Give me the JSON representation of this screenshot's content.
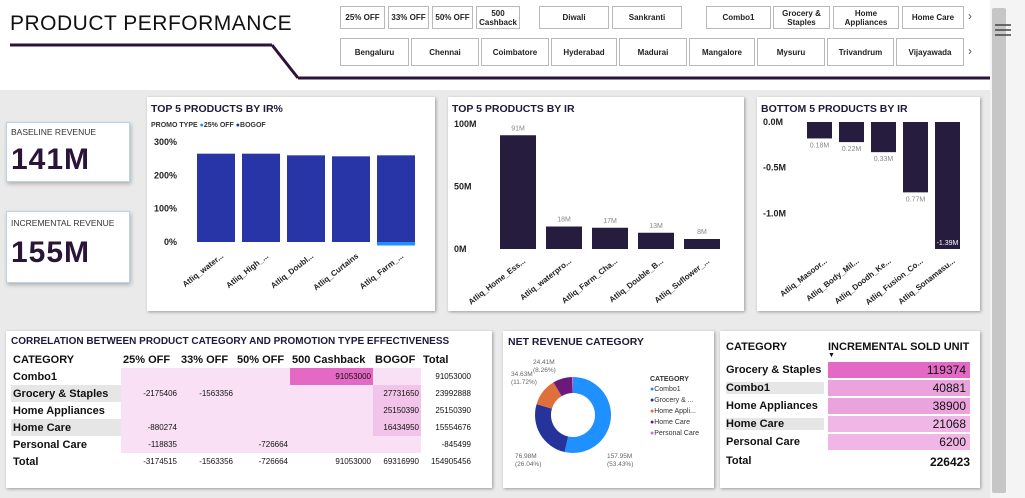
{
  "header": {
    "title": "PRODUCT PERFORMANCE"
  },
  "slicers": {
    "promo": [
      "25% OFF",
      "33% OFF",
      "50% OFF",
      "500 Cashback"
    ],
    "campaign": [
      "Diwali",
      "Sankranti"
    ],
    "category": [
      "Combo1",
      "Grocery & Staples",
      "Home Appliances",
      "Home Care"
    ],
    "city": [
      "Bengaluru",
      "Chennai",
      "Coimbatore",
      "Hyderabad",
      "Madurai",
      "Mangalore",
      "Mysuru",
      "Trivandrum",
      "Vijayawada"
    ]
  },
  "kpis": {
    "baseline_label": "BASELINE REVENUE",
    "baseline_value": "141M",
    "incremental_label": "INCREMENTAL REVENUE",
    "incremental_value": "155M"
  },
  "colors": {
    "bogof": "#2835a6",
    "off25": "#1e90ff",
    "dark": "#251c3e",
    "pink": "#e469c4",
    "lightpink": "#f9e0f5"
  },
  "chart_data": [
    {
      "type": "bar",
      "title": "TOP 5 PRODUCTS BY IR%",
      "legend_title": "PROMO TYPE",
      "legend": [
        "25% OFF",
        "BOGOF"
      ],
      "categories": [
        "Atliq_water...",
        "Atliq_High_...",
        "Atliq_Doubl...",
        "Atliq_Curtains",
        "Atliq_Farm_..."
      ],
      "series": [
        {
          "name": "BOGOF",
          "values": [
            265,
            265,
            260,
            257,
            260
          ]
        },
        {
          "name": "25% OFF",
          "values": [
            0,
            0,
            0,
            0,
            15
          ]
        }
      ],
      "yticks": [
        "0%",
        "100%",
        "200%",
        "300%"
      ],
      "ylim": [
        0,
        300
      ]
    },
    {
      "type": "bar",
      "title": "TOP 5 PRODUCTS BY IR",
      "categories": [
        "Atliq_Home_Ess...",
        "Atliq_waterpro...",
        "Atliq_Farm_Cha...",
        "Atliq_Double_B...",
        "Atliq_Suflower_..."
      ],
      "values": [
        91,
        18,
        17,
        13,
        8
      ],
      "labels": [
        "91M",
        "18M",
        "17M",
        "13M",
        "8M"
      ],
      "yticks": [
        "0M",
        "50M",
        "100M"
      ],
      "ylim": [
        0,
        100
      ]
    },
    {
      "type": "bar",
      "title": "BOTTOM 5 PRODUCTS BY IR",
      "categories": [
        "Atliq_Masoor...",
        "Atliq_Body_Mil...",
        "Atliq_Doodh_Ke...",
        "Atliq_Fusion_Co...",
        "Atliq_Sonamasu..."
      ],
      "values": [
        -0.18,
        -0.22,
        -0.33,
        -0.77,
        -1.39
      ],
      "labels": [
        "0.18M",
        "0.22M",
        "0.33M",
        "0.77M",
        "-1.39M"
      ],
      "yticks": [
        "0.0M",
        "-0.5M",
        "-1.0M"
      ],
      "ylim": [
        -1.39,
        0
      ]
    },
    {
      "type": "pie",
      "title": "NET REVENUE CATEGORY",
      "legend_title": "CATEGORY",
      "legend": [
        "Combo1",
        "Grocery & ...",
        "Home Appli...",
        "Home Care",
        "Personal Care"
      ],
      "values": [
        157.95,
        76.98,
        34.63,
        24.41,
        1
      ],
      "colors": [
        "#1e90ff",
        "#26339a",
        "#e0703a",
        "#6b1a7c",
        "#e469c4"
      ],
      "labels": [
        "157.95M\n(53.43%)",
        "76.98M\n(26.04%)",
        "34.63M\n(11.72%)",
        "24.41M\n(8.26%)"
      ]
    }
  ],
  "matrix": {
    "title": "CORRELATION BETWEEN PRODUCT CATEGORY AND PROMOTION TYPE EFFECTIVENESS",
    "columns": [
      "CATEGORY",
      "25% OFF",
      "33% OFF",
      "50% OFF",
      "500 Cashback",
      "BOGOF",
      "Total"
    ],
    "rows": [
      [
        "Combo1",
        "",
        "",
        "",
        "91053000",
        "",
        "91053000"
      ],
      [
        "Grocery & Staples",
        "-2175406",
        "-1563356",
        "",
        "",
        "27731650",
        "23992888"
      ],
      [
        "Home Appliances",
        "",
        "",
        "",
        "",
        "25150390",
        "25150390"
      ],
      [
        "Home Care",
        "-880274",
        "",
        "",
        "",
        "16434950",
        "15554676"
      ],
      [
        "Personal Care",
        "-118835",
        "",
        "-726664",
        "",
        "",
        "-845499"
      ],
      [
        "Total",
        "-3174515",
        "-1563356",
        "-726664",
        "91053000",
        "69316990",
        "154905456"
      ]
    ]
  },
  "units_table": {
    "columns": [
      "CATEGORY",
      "INCREMENTAL SOLD UNIT"
    ],
    "rows": [
      [
        "Grocery & Staples",
        "119374"
      ],
      [
        "Combo1",
        "40881"
      ],
      [
        "Home Appliances",
        "38900"
      ],
      [
        "Home Care",
        "21068"
      ],
      [
        "Personal Care",
        "6200"
      ]
    ],
    "total_label": "Total",
    "total_value": "226423"
  }
}
